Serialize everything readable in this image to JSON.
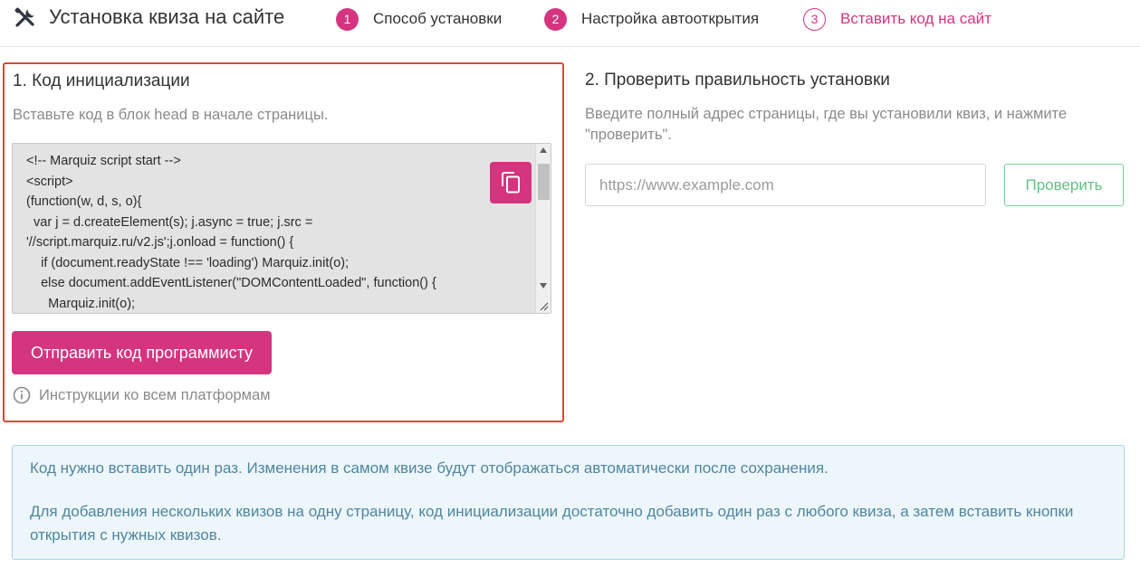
{
  "header": {
    "title": "Установка квиза на сайте",
    "steps": [
      {
        "num": "1",
        "label": "Способ установки"
      },
      {
        "num": "2",
        "label": "Настройка автооткрытия"
      },
      {
        "num": "3",
        "label": "Вставить код на сайт"
      }
    ]
  },
  "init_section": {
    "title": "1. Код инициализации",
    "subtitle": "Вставьте код в блок head в начале страницы.",
    "code": "<!-- Marquiz script start -->\n<script>\n(function(w, d, s, o){\n  var j = d.createElement(s); j.async = true; j.src =\n'//script.marquiz.ru/v2.js';j.onload = function() {\n    if (document.readyState !== 'loading') Marquiz.init(o);\n    else document.addEventListener(\"DOMContentLoaded\", function() {\n      Marquiz.init(o);",
    "copy_icon": "copy-icon",
    "send_button": "Отправить код программисту",
    "instructions_link": "Инструкции ко всем платформам",
    "info_icon": "info-icon"
  },
  "check_section": {
    "title": "2. Проверить правильность установки",
    "subtitle": "Введите полный адрес страницы, где вы установили квиз, и нажмите \"проверить\".",
    "url_placeholder": "https://www.example.com",
    "check_button": "Проверить"
  },
  "info": {
    "p1": "Код нужно вставить один раз. Изменения в самом квизе будут отображаться автоматически после сохранения.",
    "p2": "Для добавления нескольких квизов на одну страницу, код инициализации достаточно добавить один раз с любого квиза, а затем вставить кнопки открытия с нужных квизов."
  },
  "colors": {
    "accent": "#d5347f",
    "highlight_border": "#e2443a",
    "check_green": "#62c184",
    "info_bg": "#edf6fa",
    "info_text": "#4f86a0"
  }
}
